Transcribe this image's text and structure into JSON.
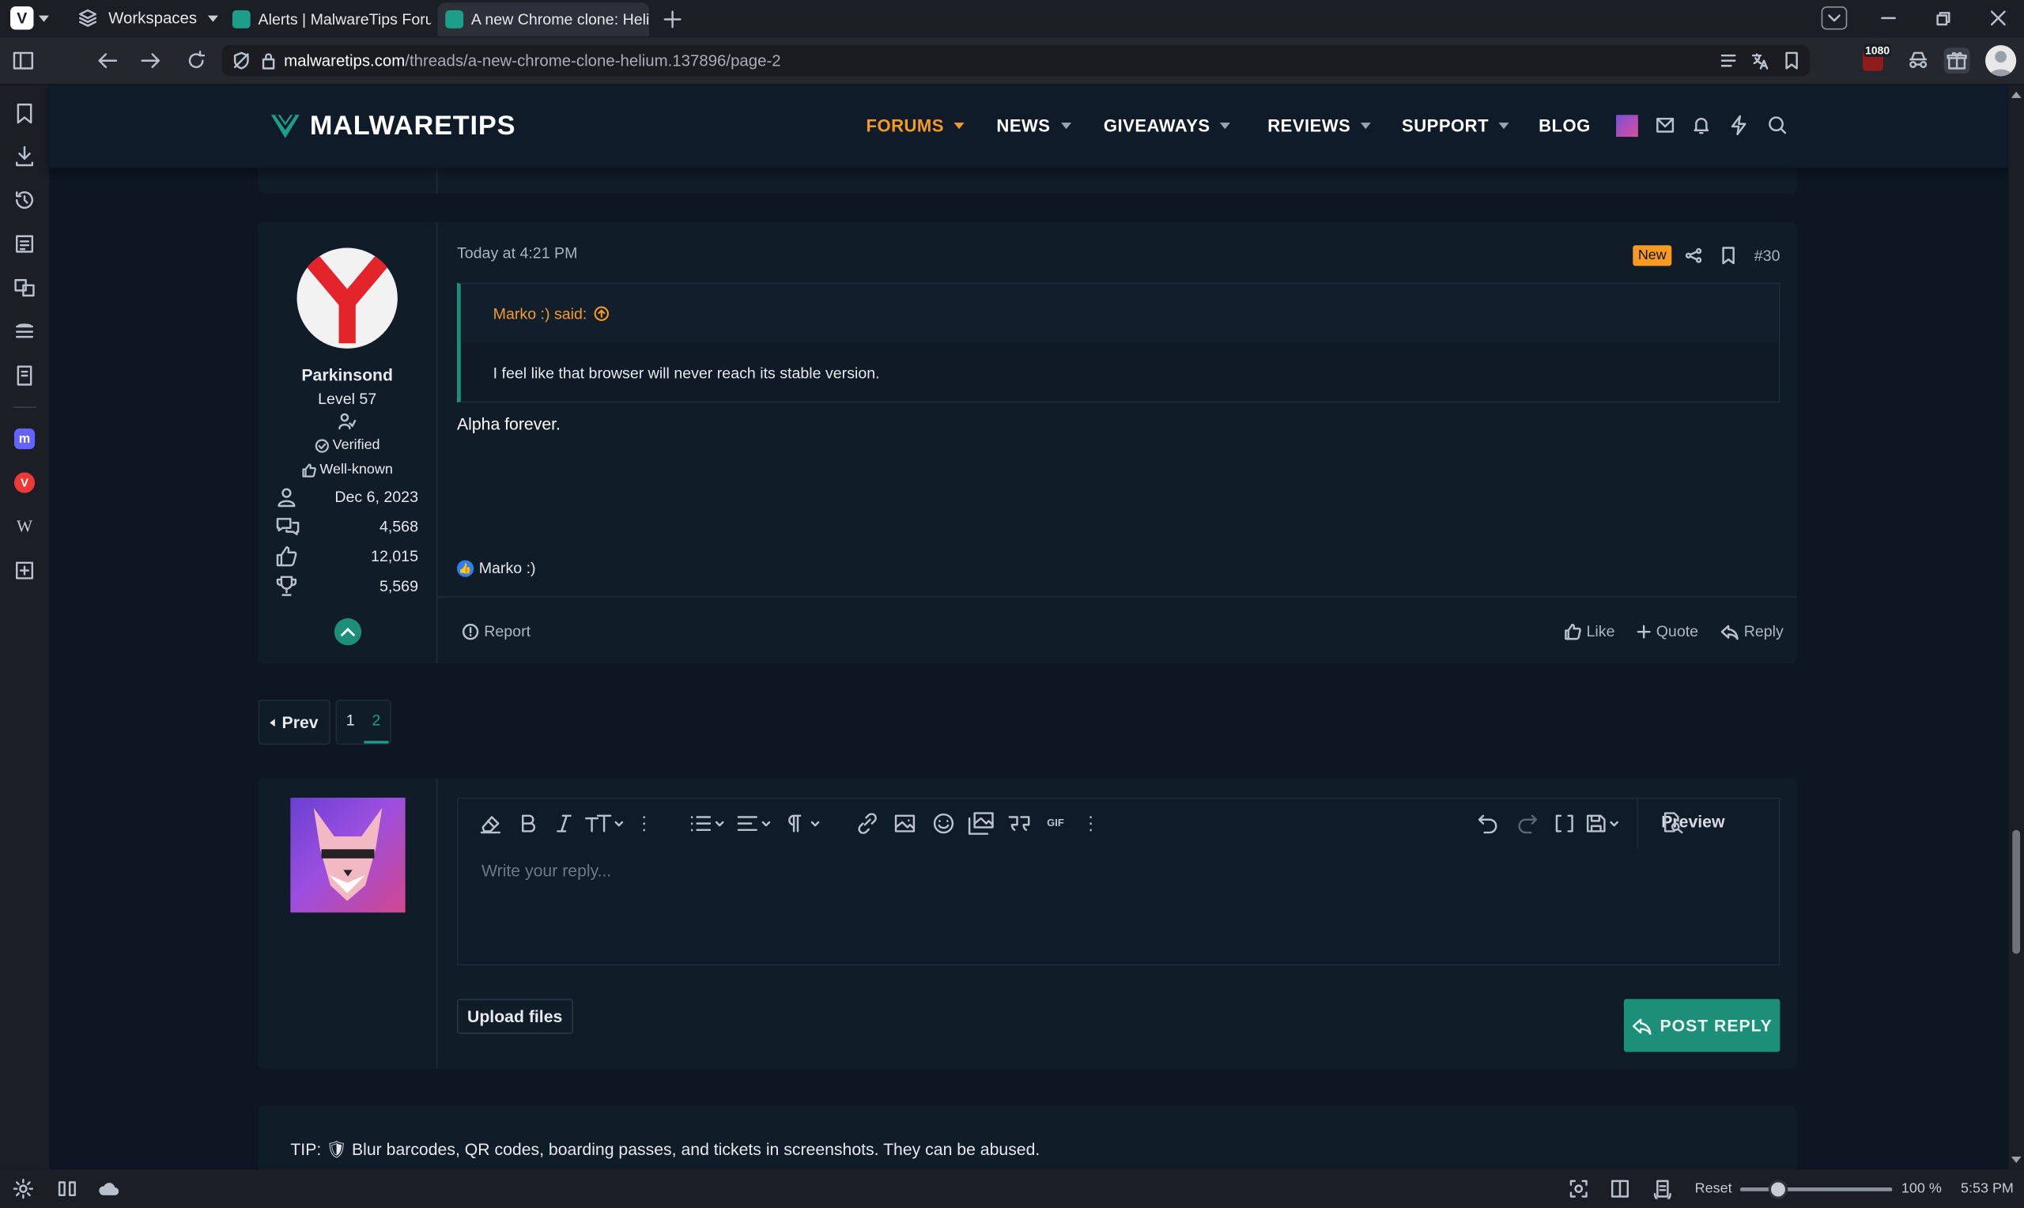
{
  "browser": {
    "workspaces_label": "Workspaces",
    "tabs": [
      {
        "title": "Alerts | MalwareTips Forum"
      },
      {
        "title": "A new Chrome clone: Helium"
      }
    ],
    "url_host": "malwaretips.com",
    "url_path": "/threads/a-new-chrome-clone-helium.137896/page-2",
    "extension_badge": "1080"
  },
  "site": {
    "logo": "MALWARETIPS",
    "nav": [
      {
        "label": "FORUMS"
      },
      {
        "label": "NEWS"
      },
      {
        "label": "GIVEAWAYS"
      },
      {
        "label": "REVIEWS"
      },
      {
        "label": "SUPPORT"
      },
      {
        "label": "BLOG"
      }
    ]
  },
  "post": {
    "timestamp": "Today at 4:21 PM",
    "new_badge": "New",
    "post_number": "#30",
    "author": {
      "name": "Parkinsond",
      "level": "Level 57",
      "verified": "Verified",
      "reputation": "Well-known",
      "joined": "Dec 6, 2023",
      "messages": "4,568",
      "reactions": "12,015",
      "points": "5,569"
    },
    "quote_author": "Marko :) said:",
    "quote_text": "I feel like that browser will never reach its stable version.",
    "body": "Alpha forever.",
    "reaction_user": "Marko :)",
    "report_label": "Report",
    "like_label": "Like",
    "quote_label": "Quote",
    "reply_label": "Reply"
  },
  "pagination": {
    "prev_label": "Prev",
    "pages": [
      "1",
      "2"
    ]
  },
  "editor": {
    "placeholder": "Write your reply...",
    "preview_label": "Preview",
    "upload_label": "Upload files",
    "post_reply_label": "POST REPLY"
  },
  "tip": "TIP: 🛡 Blur barcodes, QR codes, boarding passes, and tickets in screenshots. They can be abused.",
  "statusbar": {
    "reset_label": "Reset",
    "zoom": "100 %",
    "zoom_level": 0.25,
    "time": "5:53 PM"
  },
  "colors": {
    "accent": "#f59a23",
    "teal": "#1d8f78",
    "page_bg": "#0d1622",
    "card_bg": "#111c29"
  }
}
